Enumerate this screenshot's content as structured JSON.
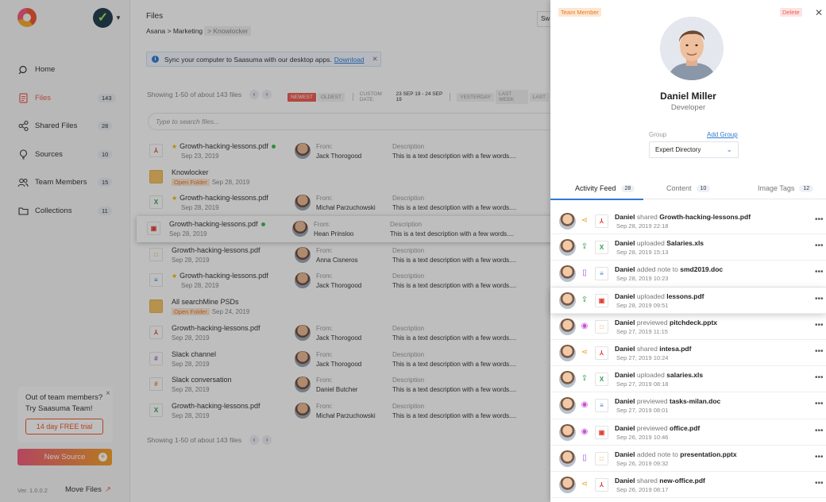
{
  "sidebar": {
    "nav": [
      {
        "label": "Home",
        "icon": "search-icon",
        "badge": ""
      },
      {
        "label": "Files",
        "icon": "file-icon",
        "badge": "143",
        "active": true
      },
      {
        "label": "Shared Files",
        "icon": "share-icon",
        "badge": "28"
      },
      {
        "label": "Sources",
        "icon": "bulb-icon",
        "badge": "10"
      },
      {
        "label": "Team Members",
        "icon": "people-icon",
        "badge": "15"
      },
      {
        "label": "Collections",
        "icon": "folder-icon",
        "badge": "11"
      }
    ],
    "promo": {
      "line1": "Out of team members?",
      "line2": "Try Saasuma Team!",
      "button": "14 day FREE trial",
      "close": "×"
    },
    "new_source": "New Source",
    "version": "Ver. 1.0.0.2",
    "move_files": "Move Files"
  },
  "main": {
    "title": "Files",
    "breadcrumb": {
      "part1": "Asana",
      "sep": ">",
      "part2": "Marketing",
      "current": "Knowlocker"
    },
    "switch_label": "Sw",
    "sync": {
      "text": "Sync your computer to Saasuma with our desktop apps.",
      "link": "Download"
    },
    "showing": "Showing 1-50 of about 143 files",
    "filters": {
      "newest": "NEWEST",
      "oldest": "OLDEST",
      "custom": "CUSTOM DATE:",
      "dates": "23 SEP 19 - 24 SEP 19",
      "yesterday": "YESTERDAY",
      "last_week": "LAST WEEK",
      "last": "LAST"
    },
    "search_placeholder": "Type to search files...",
    "from_label": "From:",
    "desc_label": "Description",
    "open_folder": "Open Folder",
    "files": [
      {
        "name": "Growth-hacking-lessons.pdf",
        "date": "Sep 23, 2019",
        "type": "pdf",
        "starred": true,
        "online": true,
        "from": "Jack Thorogood",
        "desc": "This is a text description with a few words...."
      },
      {
        "name": "Knowlocker",
        "date": "Sep 28, 2019",
        "type": "folder",
        "starred": false,
        "folder": true
      },
      {
        "name": "Growth-hacking-lessons.pdf",
        "date": "Sep 28, 2019",
        "type": "xls",
        "starred": true,
        "from": "Michał Parzuchowski",
        "desc": "This is a text description with a few words...."
      },
      {
        "name": "Growth-hacking-lessons.pdf",
        "date": "Sep 28, 2019",
        "type": "img",
        "starred": false,
        "online": true,
        "from": "Hean Prinsloo",
        "desc": "This is a text description with a few words....",
        "highlight": true
      },
      {
        "name": "Growth-hacking-lessons.pdf",
        "date": "Sep 28, 2019",
        "type": "ppt",
        "starred": false,
        "from": "Anna Cisneros",
        "desc": "This is a text description with a few words...."
      },
      {
        "name": "Growth-hacking-lessons.pdf",
        "date": "Sep 28, 2019",
        "type": "doc",
        "starred": true,
        "from": "Jack Thorogood",
        "desc": "This is a text description with a few words...."
      },
      {
        "name": "All searchMine PSDs",
        "date": "Sep 24, 2019",
        "type": "folder",
        "starred": false,
        "folder": true
      },
      {
        "name": "Growth-hacking-lessons.pdf",
        "date": "Sep 28, 2019",
        "type": "pdf",
        "starred": false,
        "from": "Jack Thorogood",
        "desc": "This is a text description with a few words...."
      },
      {
        "name": "Slack channel",
        "date": "Sep 28, 2019",
        "type": "slack",
        "starred": false,
        "from": "Jack Thorogood",
        "desc": "This is a text description with a few words...."
      },
      {
        "name": "Slack conversation",
        "date": "Sep 28, 2019",
        "type": "slack2",
        "starred": false,
        "from": "Daniel Butcher",
        "desc": "This is a text description with a few words...."
      },
      {
        "name": "Growth-hacking-lessons.pdf",
        "date": "Sep 28, 2019",
        "type": "xls",
        "starred": false,
        "from": "Michał Parzuchowski",
        "desc": "This is a text description with a few words...."
      }
    ],
    "showing_bottom": "Showing 1-50 of about 143 files"
  },
  "panel": {
    "role_tag": "Team Member",
    "delete": "Delete",
    "name": "Daniel Miller",
    "role": "Developer",
    "group_label": "Group",
    "add_group": "Add Group",
    "group_value": "Expert Directory",
    "tabs": [
      {
        "label": "Activity Feed",
        "count": "28"
      },
      {
        "label": "Content",
        "count": "10"
      },
      {
        "label": "Image Tags",
        "count": "12"
      }
    ],
    "feed": [
      {
        "user": "Daniel",
        "verb": "shared",
        "object": "Growth-hacking-lessons.pdf",
        "date": "Sep 28, 2019 22:18",
        "action": "share",
        "type": "pdf"
      },
      {
        "user": "Daniel",
        "verb": "uploaded",
        "object": "Salaries.xls",
        "date": "Sep 28, 2019 15:13",
        "action": "upload",
        "type": "xls"
      },
      {
        "user": "Daniel",
        "verb": "added note to",
        "object": "smd2019.doc",
        "date": "Sep 28, 2019 10:23",
        "action": "note",
        "type": "doc"
      },
      {
        "user": "Daniel",
        "verb": "uploaded",
        "object": "lessons.pdf",
        "date": "Sep 28, 2019 09:51",
        "action": "upload",
        "type": "img",
        "highlight": true
      },
      {
        "user": "Daniel",
        "verb": "previewed",
        "object": "pitchdeck.pptx",
        "date": "Sep 27, 2019 11:15",
        "action": "view",
        "type": "ppt"
      },
      {
        "user": "Daniel",
        "verb": "shared",
        "object": "intesa.pdf",
        "date": "Sep 27, 2019 10:24",
        "action": "share",
        "type": "pdf"
      },
      {
        "user": "Daniel",
        "verb": "uploaded",
        "object": "salaries.xls",
        "date": "Sep 27, 2019 08:18",
        "action": "upload",
        "type": "xls"
      },
      {
        "user": "Daniel",
        "verb": "previewed",
        "object": "tasks-milan.doc",
        "date": "Sep 27, 2019 08:01",
        "action": "view",
        "type": "doc"
      },
      {
        "user": "Daniel",
        "verb": "previewed",
        "object": "office.pdf",
        "date": "Sep 26, 2019 10:46",
        "action": "view",
        "type": "img"
      },
      {
        "user": "Daniel",
        "verb": "added note to",
        "object": "presentation.pptx",
        "date": "Sep 26, 2019 09:32",
        "action": "note",
        "type": "ppt"
      },
      {
        "user": "Daniel",
        "verb": "shared",
        "object": "new-office.pdf",
        "date": "Sep 26, 2019 08:17",
        "action": "share",
        "type": "pdf"
      }
    ]
  },
  "colors": {
    "accent": "#f05a4f",
    "link": "#2f7bd6",
    "orange": "#f4a025"
  }
}
